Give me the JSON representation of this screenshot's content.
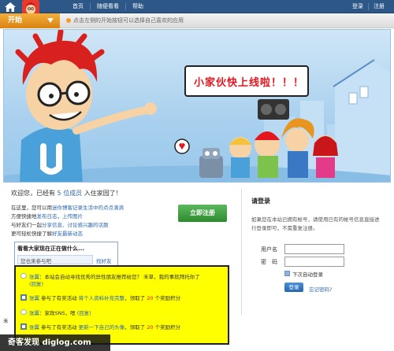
{
  "topnav": {
    "items": [
      "首页",
      "随便看看",
      "帮助"
    ],
    "right": [
      "登录",
      "注册"
    ]
  },
  "startbar": {
    "start_label": "开始",
    "hint": "点击左侧的开始按钮可以选择自己喜欢的应用"
  },
  "banner": {
    "speech": "小家伙快上线啦！！！"
  },
  "welcome": {
    "prefix": "欢迎您，已经有",
    "count": "5",
    "middle": "位成员",
    "link": "入住家园了",
    "suffix": "！",
    "desc1_a": "在这里，您可以用",
    "desc1_link": "迷你博客记录生活中的点点滴滴",
    "desc2_a": "方便快捷地",
    "desc2_link1": "发布日志",
    "desc2_sep": "，",
    "desc2_link2": "上传图片",
    "desc3_a": "与好友们一起",
    "desc3_link": "分享信息、讨论感兴趣的话题",
    "desc4_a": "更可轻松快捷了解",
    "desc4_link": "好友最新动态",
    "register_label": "立即注册"
  },
  "login": {
    "title": "请登录",
    "desc": "如果您在本站已拥有帐号，请使用已有的帐号信息直接进行登录即可，不需重复注册。",
    "username_label": "用户名",
    "password_label": "密　码",
    "remember_label": "下次自动登录",
    "submit_label": "登录",
    "forgot_label": "忘记密码?"
  },
  "status": {
    "title": "看看大家现在正在做什么...",
    "placeholder": "您也来参与吧",
    "find_label": "找好友"
  },
  "feed": [
    {
      "name": "张翼",
      "text": "：本站会自动寻找优秀的异性朋友推荐给您？ 禾草，我的事就拜托你了",
      "extra": "(回复)"
    },
    {
      "name": "张翼",
      "text_a": "参与了有奖活动",
      "act": "将个人资料补充完整",
      "text_b": "，领取了",
      "num": "20",
      "text_c": "个奖励积分"
    },
    {
      "name": "张翼",
      "text": "：家政SNS，嗯",
      "extra": "(回复)"
    },
    {
      "name": "张翼",
      "text_a": "参与了有奖活动",
      "act": "更新一下自己的头像",
      "text_b": "，领取了",
      "num": "20",
      "text_c": "个奖励积分"
    }
  ],
  "side_stub": "禾",
  "watermark": "奇客发现 diglog.com",
  "colors": {
    "topbar": "#2d5787",
    "start": "#e8961f",
    "register": "#3a9a3a",
    "feed_bg": "#ffff00",
    "link": "#2b66b1",
    "highlight": "#e5161f"
  }
}
